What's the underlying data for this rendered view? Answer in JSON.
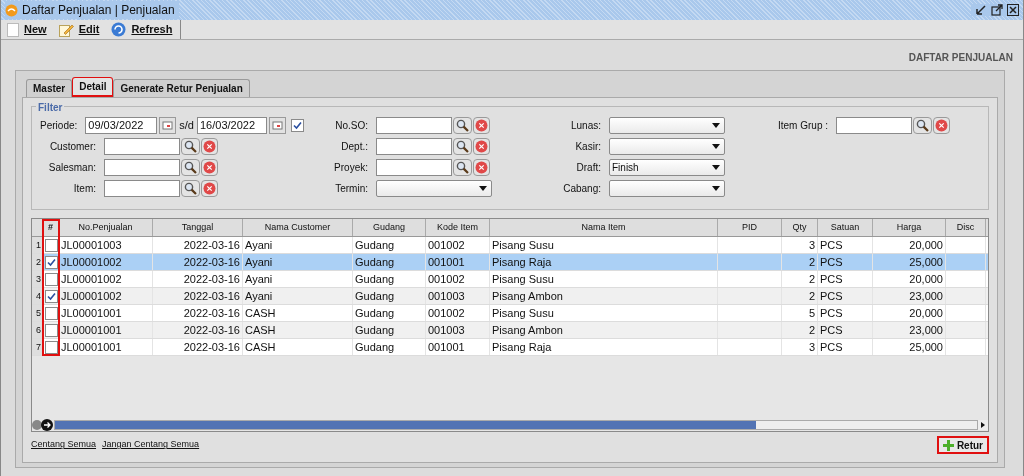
{
  "window": {
    "title": "Daftar Penjualan | Penjualan"
  },
  "toolbar": [
    {
      "label": "New",
      "kind": "new"
    },
    {
      "label": "Edit",
      "kind": "edit"
    },
    {
      "label": "Refresh",
      "kind": "refresh"
    }
  ],
  "heading": "DAFTAR PENJUALAN",
  "tabs": [
    {
      "label": "Master",
      "selected": false,
      "highlighted": false
    },
    {
      "label": "Detail",
      "selected": true,
      "highlighted": true
    },
    {
      "label": "Generate Retur Penjualan",
      "selected": false,
      "highlighted": false
    }
  ],
  "filter": {
    "title": "Filter",
    "columns": [
      [
        {
          "label": "Periode:",
          "kind": "date_range",
          "from": "09/03/2022",
          "separator": "s/d",
          "to": "16/03/2022",
          "checked": true
        },
        {
          "label": "Customer:",
          "kind": "lookup"
        },
        {
          "label": "Salesman:",
          "kind": "lookup"
        },
        {
          "label": "Item:",
          "kind": "lookup"
        }
      ],
      [
        {
          "label": "No.SO:",
          "kind": "lookup"
        },
        {
          "label": "Dept.:",
          "kind": "lookup"
        },
        {
          "label": "Proyek:",
          "kind": "lookup"
        },
        {
          "label": "Termin:",
          "kind": "dropdown"
        }
      ],
      [
        {
          "label": "Lunas:",
          "kind": "dropdown"
        },
        {
          "label": "Kasir:",
          "kind": "dropdown"
        },
        {
          "label": "Draft:",
          "kind": "dropdown",
          "value": "Finish"
        },
        {
          "label": "Cabang:",
          "kind": "dropdown"
        }
      ],
      [
        {
          "label": "Item Grup :",
          "kind": "lookup"
        }
      ]
    ]
  },
  "table": {
    "check_column_highlighted": true,
    "check_column_header": "#",
    "columns": [
      "No.Penjualan",
      "Tanggal",
      "Nama Customer",
      "Gudang",
      "Kode Item",
      "Nama Item",
      "PID",
      "Qty",
      "Satuan",
      "Harga",
      "Disc"
    ],
    "rows": [
      {
        "number": "1",
        "checked": false,
        "selected": false,
        "cells": [
          "JL00001003",
          "2022-03-16",
          "Ayani",
          "Gudang",
          "001002",
          "Pisang Susu",
          "",
          "3",
          "PCS",
          "20,000",
          ""
        ]
      },
      {
        "number": "2",
        "checked": true,
        "selected": true,
        "cells": [
          "JL00001002",
          "2022-03-16",
          "Ayani",
          "Gudang",
          "001001",
          "Pisang Raja",
          "",
          "2",
          "PCS",
          "25,000",
          ""
        ]
      },
      {
        "number": "3",
        "checked": false,
        "selected": false,
        "cells": [
          "JL00001002",
          "2022-03-16",
          "Ayani",
          "Gudang",
          "001002",
          "Pisang Susu",
          "",
          "2",
          "PCS",
          "20,000",
          ""
        ]
      },
      {
        "number": "4",
        "checked": true,
        "selected": false,
        "cells": [
          "JL00001002",
          "2022-03-16",
          "Ayani",
          "Gudang",
          "001003",
          "Pisang Ambon",
          "",
          "2",
          "PCS",
          "23,000",
          ""
        ]
      },
      {
        "number": "5",
        "checked": false,
        "selected": false,
        "cells": [
          "JL00001001",
          "2022-03-16",
          "CASH",
          "Gudang",
          "001002",
          "Pisang Susu",
          "",
          "5",
          "PCS",
          "20,000",
          ""
        ]
      },
      {
        "number": "6",
        "checked": false,
        "selected": false,
        "cells": [
          "JL00001001",
          "2022-03-16",
          "CASH",
          "Gudang",
          "001003",
          "Pisang Ambon",
          "",
          "2",
          "PCS",
          "23,000",
          ""
        ]
      },
      {
        "number": "7",
        "checked": false,
        "selected": false,
        "cells": [
          "JL00001001",
          "2022-03-16",
          "CASH",
          "Gudang",
          "001001",
          "Pisang Raja",
          "",
          "3",
          "PCS",
          "25,000",
          ""
        ]
      }
    ]
  },
  "links": [
    "Centang Semua",
    "Jangan Centang Semua"
  ],
  "retur_button": {
    "label": "Retur",
    "highlighted": true
  }
}
